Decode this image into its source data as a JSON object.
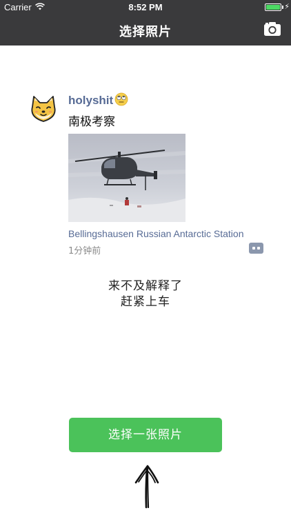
{
  "status_bar": {
    "carrier": "Carrier",
    "time": "8:52 PM",
    "battery_level": 1.0
  },
  "nav": {
    "title": "选择照片",
    "camera_icon": "camera-icon"
  },
  "post": {
    "avatar_icon": "shiba-dog-avatar",
    "username": "holyshit",
    "username_emoji": "rolling-eyes-emoji",
    "text": "南极考察",
    "photo": "helicopter-snow-photo",
    "location": "Bellingshausen Russian Antarctic Station",
    "timestamp": "1分钟前",
    "comment_icon": "comment-more-icon"
  },
  "caption": {
    "line1": "来不及解释了",
    "line2": "赶紧上车"
  },
  "action": {
    "choose_photo_label": "选择一张照片",
    "arrow_icon": "hand-drawn-up-arrow"
  },
  "colors": {
    "nav_background": "#3a3a3c",
    "link_blue": "#576b95",
    "button_green": "#4bc25a",
    "battery_green": "#4cd964"
  }
}
